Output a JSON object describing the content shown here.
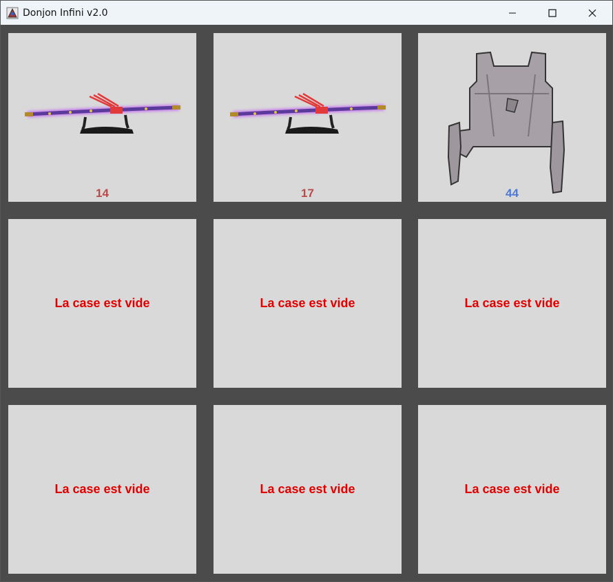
{
  "window": {
    "title": "Donjon Infini v2.0"
  },
  "inventory": {
    "slots": [
      {
        "type": "weapon",
        "item_icon": "katana-icon",
        "value": "14"
      },
      {
        "type": "weapon",
        "item_icon": "katana-icon",
        "value": "17"
      },
      {
        "type": "armor",
        "item_icon": "armor-vest-icon",
        "value": "44"
      },
      {
        "type": "empty",
        "label": "La case est vide"
      },
      {
        "type": "empty",
        "label": "La case est vide"
      },
      {
        "type": "empty",
        "label": "La case est vide"
      },
      {
        "type": "empty",
        "label": "La case est vide"
      },
      {
        "type": "empty",
        "label": "La case est vide"
      },
      {
        "type": "empty",
        "label": "La case est vide"
      }
    ]
  },
  "colors": {
    "background": "#4b4b4b",
    "cell": "#d9d9d9",
    "weapon_value": "#b84a4a",
    "armor_value": "#4f79d8",
    "empty_text": "#e00000"
  }
}
